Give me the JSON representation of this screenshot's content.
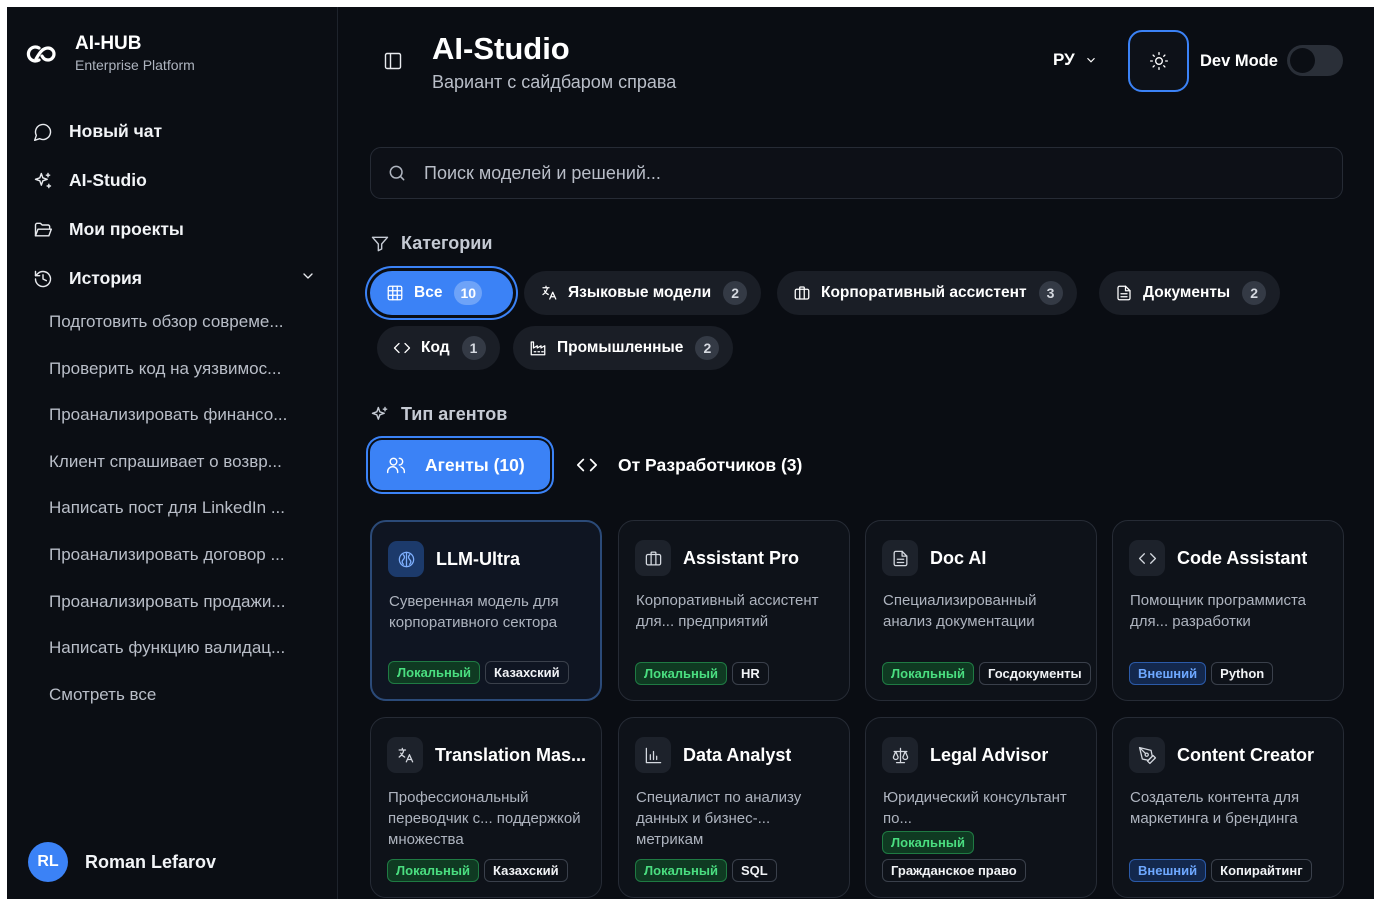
{
  "brand": {
    "name": "AI-HUB",
    "subtitle": "Enterprise Platform"
  },
  "nav": {
    "new_chat": "Новый чат",
    "ai_studio": "AI-Studio",
    "projects": "Мои проекты",
    "history": "История"
  },
  "history": [
    "Подготовить обзор совреме...",
    "Проверить код на уязвимос...",
    "Проанализировать финансо...",
    "Клиент спрашивает о возвр...",
    "Написать пост для LinkedIn ...",
    "Проанализировать договор ...",
    "Проанализировать продажи...",
    "Написать функцию валидац...",
    "Смотреть все"
  ],
  "user": {
    "initials": "RL",
    "name": "Roman Lefarov"
  },
  "header": {
    "title": "AI-Studio",
    "subtitle": "Вариант с сайдбаром справа",
    "lang": "РУ",
    "dev_mode": "Dev Mode"
  },
  "search": {
    "placeholder": "Поиск моделей и решений..."
  },
  "categories": {
    "label": "Категории",
    "items": [
      {
        "label": "Все",
        "count": "10",
        "icon": "grid-icon"
      },
      {
        "label": "Языковые модели",
        "count": "2",
        "icon": "translate-icon"
      },
      {
        "label": "Корпоративный ассистент",
        "count": "3",
        "icon": "briefcase-icon"
      },
      {
        "label": "Документы",
        "count": "2",
        "icon": "document-icon"
      },
      {
        "label": "Код",
        "count": "1",
        "icon": "code-icon"
      },
      {
        "label": "Промышленные",
        "count": "2",
        "icon": "factory-icon"
      }
    ]
  },
  "agent_types": {
    "label": "Тип агентов",
    "agents": "Агенты (10)",
    "developers": "От Разработчиков (3)"
  },
  "cards": [
    {
      "title": "LLM-Ultra",
      "desc": "Суверенная модель для корпоративного сектора",
      "tags": [
        "Локальный",
        "Казахский"
      ],
      "icon": "brain-icon"
    },
    {
      "title": "Assistant Pro",
      "desc": "Корпоративный ассистент для... предприятий",
      "tags": [
        "Локальный",
        "HR"
      ],
      "icon": "briefcase-icon"
    },
    {
      "title": "Doc AI",
      "desc": "Специализированный анализ документации",
      "tags": [
        "Локальный",
        "Госдокументы"
      ],
      "icon": "document-icon"
    },
    {
      "title": "Code Assistant",
      "desc": "Помощник программиста для... разработки",
      "tags": [
        "Внешний",
        "Python"
      ],
      "icon": "code-icon"
    },
    {
      "title": "Translation Mas...",
      "desc": "Профессиональный переводчик с... поддержкой множества",
      "tags": [
        "Локальный",
        "Казахский"
      ],
      "icon": "translate-icon"
    },
    {
      "title": "Data Analyst",
      "desc": "Специалист по анализу данных и бизнес-... метрикам",
      "tags": [
        "Локальный",
        "SQL"
      ],
      "icon": "chart-icon"
    },
    {
      "title": "Legal Advisor",
      "desc": "Юридический консультант по...",
      "tags": [
        "Локальный",
        "Гражданское право"
      ],
      "icon": "scales-icon"
    },
    {
      "title": "Content Creator",
      "desc": "Создатель контента для маркетинга и брендинга",
      "tags": [
        "Внешний",
        "Копирайтинг"
      ],
      "icon": "pen-icon"
    }
  ],
  "colors": {
    "accent": "#3b82f6",
    "background": "#0a0d13",
    "local_tag": "#4ade80",
    "external_tag": "#6ea8ff"
  }
}
